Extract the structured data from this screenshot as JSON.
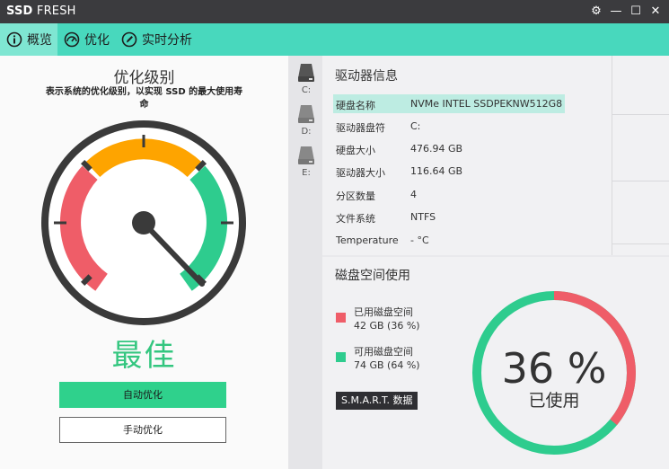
{
  "app": {
    "title_bold": "SSD",
    "title_rest": "FRESH"
  },
  "window_controls": {
    "settings": "⚙",
    "minimize": "—",
    "maximize": "☐",
    "close": "✕"
  },
  "nav": {
    "tabs": [
      {
        "label": "概览",
        "icon": "info-icon",
        "active": true
      },
      {
        "label": "优化",
        "icon": "speedometer-icon",
        "active": false
      },
      {
        "label": "实时分析",
        "icon": "pen-icon",
        "active": false
      }
    ]
  },
  "optimization": {
    "heading": "优化级别",
    "description": "表示系统的优化级别，以实现 SSD 的最大使用寿命",
    "rating": "最佳",
    "auto_button": "自动优化",
    "manual_button": "手动优化",
    "colors": {
      "red": "#ef5d68",
      "orange": "#fea400",
      "green": "#2ecc8e",
      "ring": "#3a3a3a"
    }
  },
  "drives": [
    {
      "label": "C:",
      "selected": true
    },
    {
      "label": "D:",
      "selected": false
    },
    {
      "label": "E:",
      "selected": false
    }
  ],
  "drive_info": {
    "heading": "驱动器信息",
    "rows": [
      {
        "key": "硬盘名称",
        "value": "NVMe INTEL SSDPEKNW512G8"
      },
      {
        "key": "驱动器盘符",
        "value": "C:"
      },
      {
        "key": "硬盘大小",
        "value": "476.94   GB"
      },
      {
        "key": "驱动器大小",
        "value": "116.64   GB"
      },
      {
        "key": "分区数量",
        "value": "4"
      },
      {
        "key": "文件系统",
        "value": "NTFS"
      },
      {
        "key": "Temperature",
        "value": "-  °C"
      }
    ]
  },
  "disk_usage": {
    "heading": "磁盘空间使用",
    "used": {
      "label": "已用磁盘空间",
      "detail": "42 GB (36 %)",
      "color": "#ef5d68"
    },
    "free": {
      "label": "可用磁盘空间",
      "detail": "74 GB (64 %)",
      "color": "#2ecc8e"
    },
    "smart_button": "S.M.A.R.T. 数据",
    "percent_text": "36 %",
    "percent_value": 36,
    "caption": "已使用"
  }
}
